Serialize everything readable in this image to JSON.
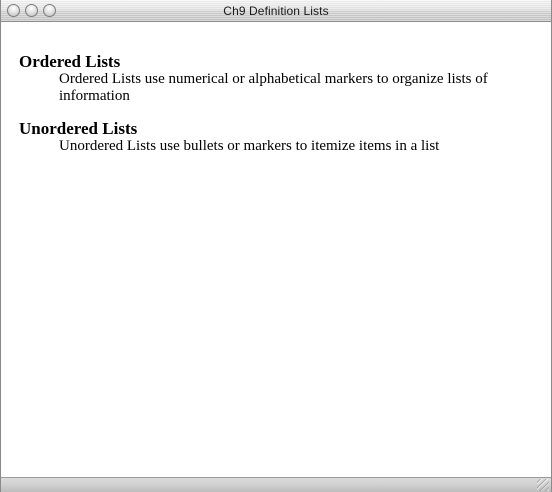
{
  "window": {
    "title": "Ch9 Definition Lists"
  },
  "definition_list": [
    {
      "term": "Ordered Lists",
      "definition": "Ordered Lists use numerical or alphabetical markers to organize lists of information"
    },
    {
      "term": "Unordered Lists",
      "definition": "Unordered Lists use bullets or markers to itemize items in a list"
    }
  ],
  "icons": {
    "close": "close-button-icon",
    "minimize": "minimize-button-icon",
    "zoom": "zoom-button-icon",
    "resize": "resize-grip-icon"
  },
  "colors": {
    "background": "#ffffff",
    "text": "#000000",
    "titlebar": "#d6d6d6"
  }
}
